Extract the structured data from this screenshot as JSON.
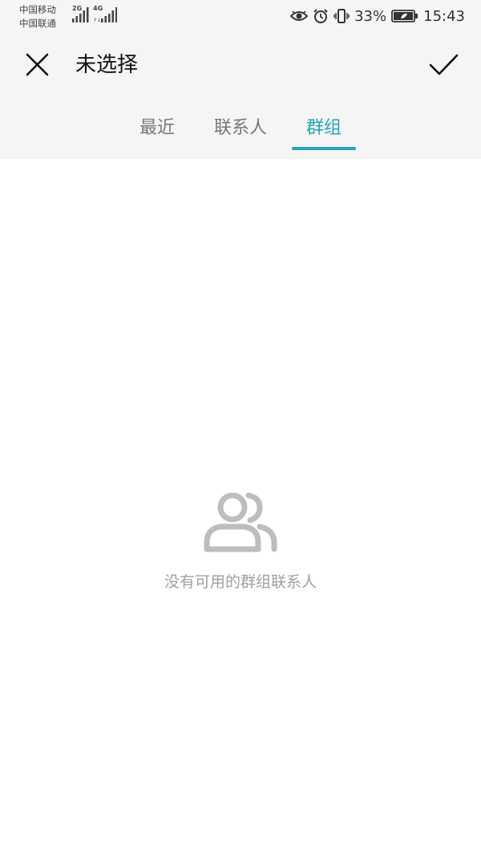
{
  "status_bar": {
    "carrier1": "中国移动",
    "carrier2": "中国联通",
    "network1": "2G",
    "network2": "4G",
    "battery": "33%",
    "time": "15:43"
  },
  "header": {
    "title": "未选择",
    "close_icon": "close-icon",
    "confirm_icon": "check-icon"
  },
  "tabs": [
    {
      "label": "最近",
      "active": false
    },
    {
      "label": "联系人",
      "active": false
    },
    {
      "label": "群组",
      "active": true
    }
  ],
  "empty_state": {
    "icon": "group-icon",
    "message": "没有可用的群组联系人"
  },
  "colors": {
    "accent": "#23a6b8",
    "header_bg": "#f5f5f5",
    "inactive_tab": "#777777",
    "empty_text": "#a0a0a0"
  }
}
